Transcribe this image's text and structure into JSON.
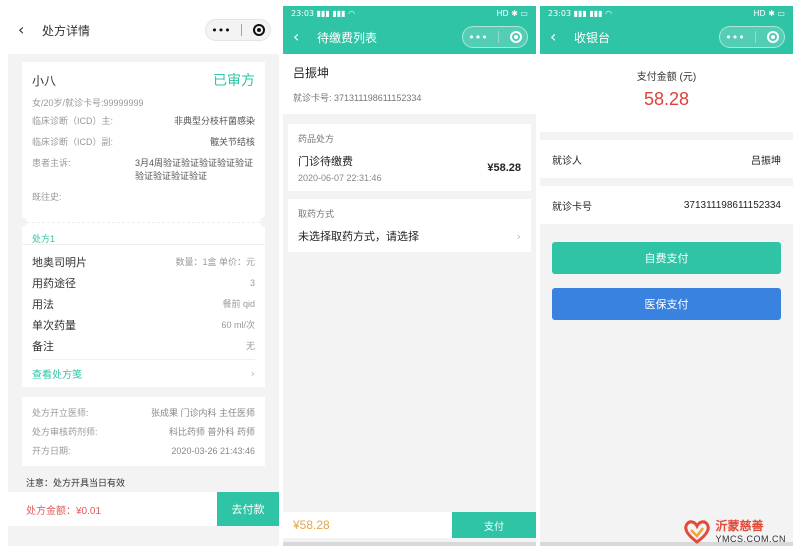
{
  "screen1": {
    "nav_title": "处方详情",
    "back_icon": "chevron-left-icon",
    "capsule_more": "•••",
    "patient_name": "小八",
    "status": "已审方",
    "patient_sub": "女/20岁/就诊卡号:99999999",
    "info": [
      {
        "label": "临床诊断（ICD）主:",
        "value": "非典型分枝杆菌感染"
      },
      {
        "label": "临床诊断（ICD）副:",
        "value": "髋关节结核"
      },
      {
        "label": "患者主诉:",
        "value": "3月4周验证验证验证验证验证验证验证验证验证"
      },
      {
        "label": "既往史:",
        "value": ""
      }
    ],
    "tab": "处方1",
    "drug": {
      "name": "地奥司明片",
      "spec": "数量：1盒 单价：元"
    },
    "drug_rows": [
      {
        "label": "用药途径",
        "value": "3"
      },
      {
        "label": "用法",
        "value": "餐前 qid"
      },
      {
        "label": "单次药量",
        "value": "60 ml/次"
      },
      {
        "label": "备注",
        "value": "无"
      }
    ],
    "view_link": "查看处方笺",
    "sign_rows": [
      {
        "label": "处方开立医师:",
        "value": "张成果 门诊内科 主任医师"
      },
      {
        "label": "处方审核药剂师:",
        "value": "科比药师 普外科 药师"
      },
      {
        "label": "开方日期:",
        "value": "2020-03-26 21:43:46"
      }
    ],
    "notice": "注意：处方开具当日有效",
    "amount": "处方金额：¥0.01",
    "pay_button": "去付款"
  },
  "screen2": {
    "status_time": "23:03",
    "status_left": "23:03 ▮▮▮ ▮▮▮ ◠",
    "status_right": "HD ✱ ▭",
    "nav_title": "待缴费列表",
    "patient_name": "吕振坤",
    "card_no": "就诊卡号: 371311198611152334",
    "section_label": "药品处方",
    "item_title": "门诊待缴费",
    "item_time": "2020-06-07 22:31:46",
    "item_price": "¥58.28",
    "method_label": "取药方式",
    "method_value": "未选择取药方式，请选择",
    "bottom_amount": "¥58.28",
    "bottom_button": "支付"
  },
  "screen3": {
    "status_left": "23:03 ▮▮▮ ▮▮▮ ◠",
    "status_right": "HD ✱ ▭",
    "nav_title": "收银台",
    "amount_label": "支付金额 (元)",
    "amount_value": "58.28",
    "rows": [
      {
        "label": "就诊人",
        "value": "吕振坤"
      },
      {
        "label": "就诊卡号",
        "value": "371311198611152334"
      }
    ],
    "self_pay": "自费支付",
    "insurance_pay": "医保支付"
  },
  "watermark": {
    "cn": "沂蒙慈善",
    "en": "YMCS.COM.CN"
  },
  "colors": {
    "accent": "#2ec4a5",
    "price_red": "#e0403a",
    "insurance_blue": "#3a82e0"
  }
}
